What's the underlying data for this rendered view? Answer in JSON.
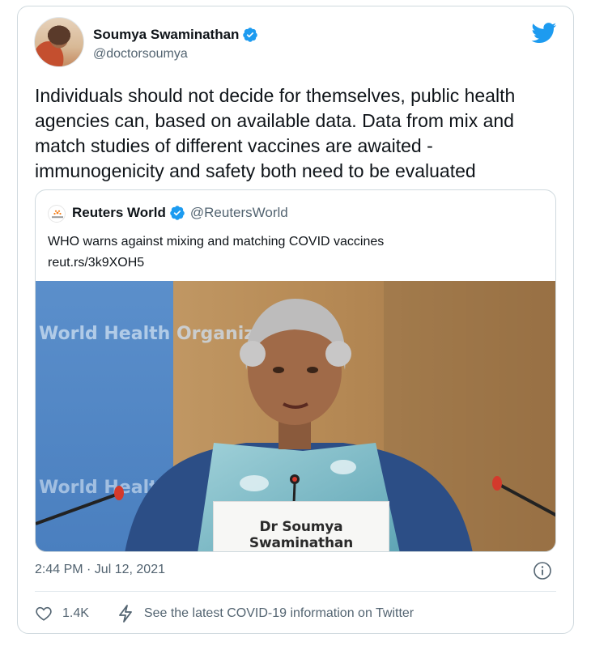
{
  "author": {
    "name": "Soumya Swaminathan",
    "handle": "@doctorsoumya",
    "verified": true
  },
  "tweet_text": "Individuals should not decide for themselves, public health agencies can, based on available data. Data from mix and match studies of different vaccines are awaited - immunogenicity and safety both need to be evaluated",
  "quoted_tweet": {
    "name": "Reuters World",
    "handle": "@ReutersWorld",
    "verified": true,
    "text": "WHO warns against mixing and matching COVID vaccines",
    "link": "reut.rs/3k9XOH5",
    "image": {
      "backdrop_text_top": "World Health Organization",
      "backdrop_text_bottom": "World Health Organization",
      "nameplate": "Dr Soumya Swaminathan"
    }
  },
  "timestamp": "2:44 PM · Jul 12, 2021",
  "likes": "1.4K",
  "covid_info": "See the latest COVID-19 information on Twitter",
  "colors": {
    "twitter_blue": "#1d9bf0",
    "text": "#0f1419",
    "secondary_text": "#536471",
    "border": "#cfd9de"
  },
  "icons": [
    "twitter-bird-icon",
    "verified-badge-icon",
    "info-icon",
    "heart-icon",
    "lightning-icon"
  ]
}
